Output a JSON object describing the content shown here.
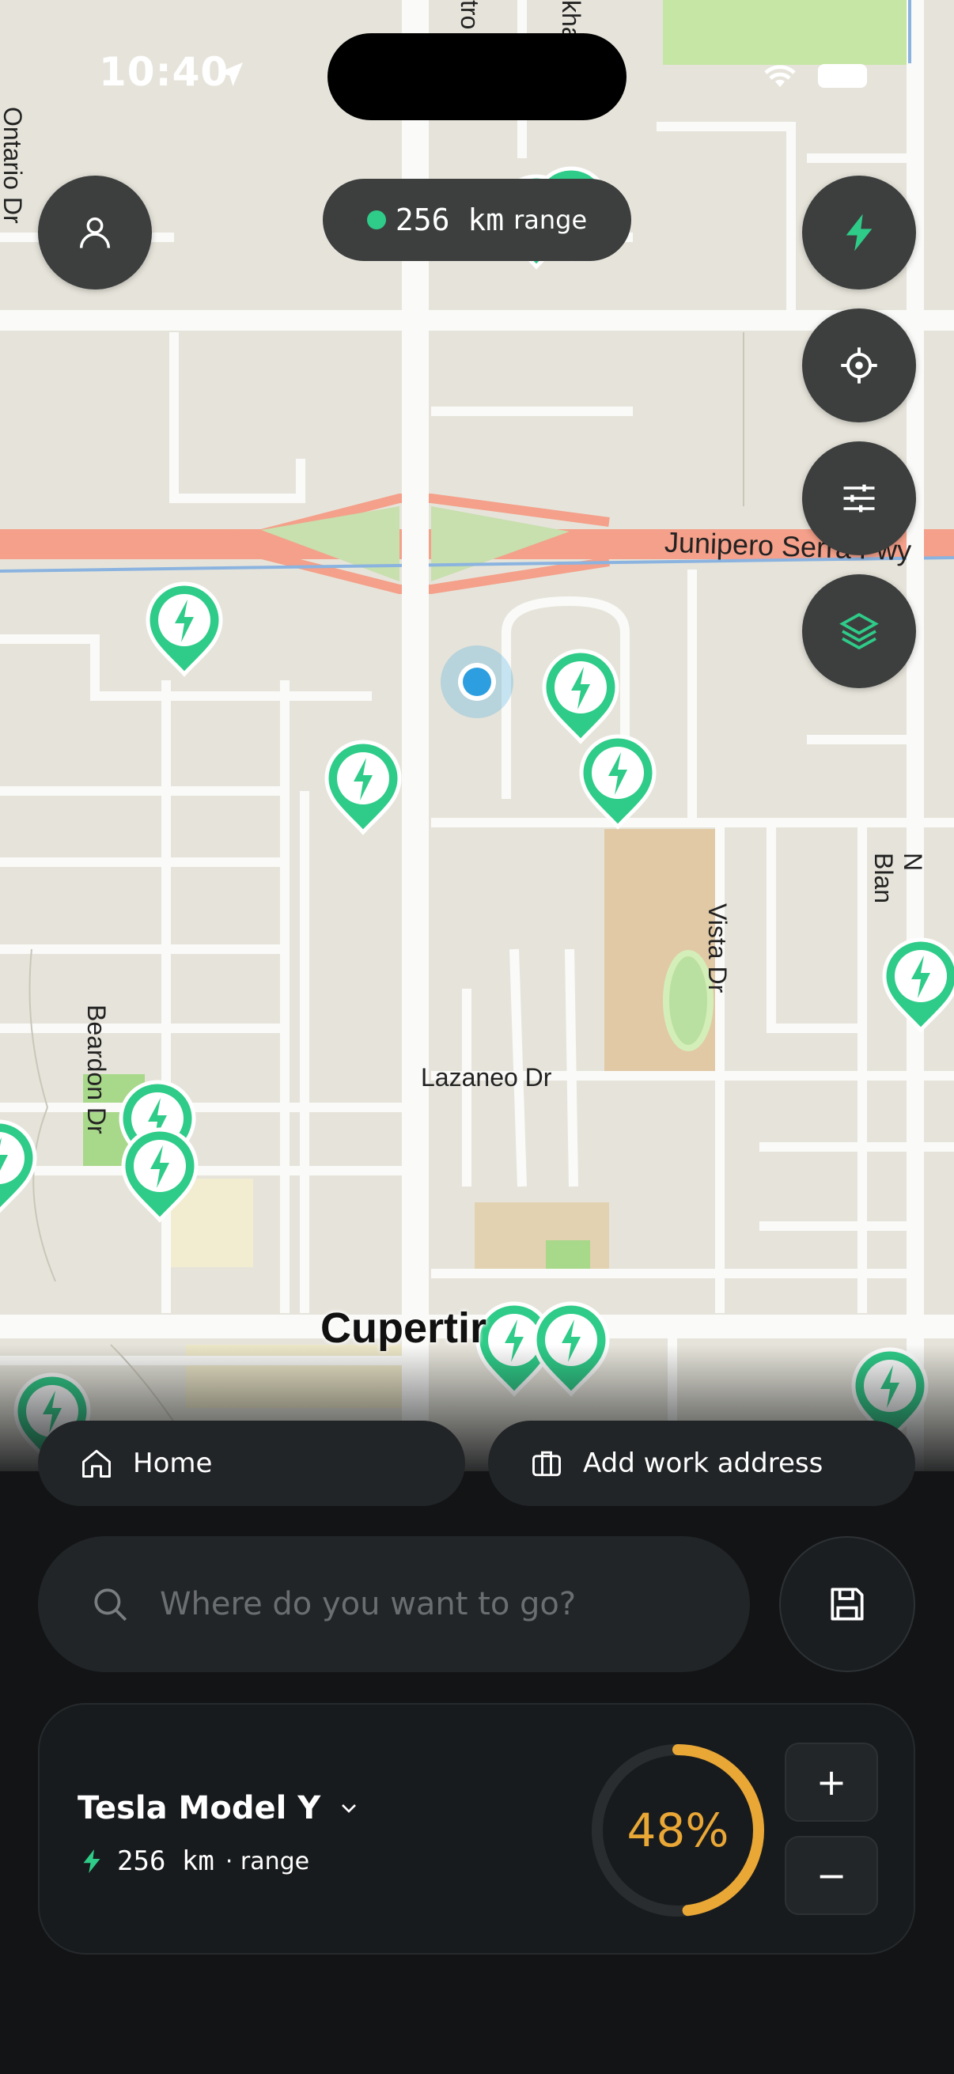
{
  "status_bar": {
    "time": "10:40"
  },
  "range_pill": {
    "value": "256 km",
    "label": "range"
  },
  "map": {
    "labels": {
      "freeway": "Junipero Serra Fwy",
      "lazaneo": "Lazaneo Dr",
      "beardon": "Beardon Dr",
      "vista": "Vista Dr",
      "ontario": "Ontario Dr",
      "blaney": "N Blan",
      "city": "Cupertir",
      "top_a": "tro",
      "top_b": "kha"
    }
  },
  "shortcuts": {
    "home": "Home",
    "work": "Add work address"
  },
  "search": {
    "placeholder": "Where do you want to go?"
  },
  "vehicle": {
    "name": "Tesla Model Y",
    "range_value": "256 km",
    "range_label": "· range",
    "battery_percent": "48%",
    "battery_level": 0.48,
    "increase_label": "+",
    "decrease_label": "−"
  },
  "colors": {
    "accent": "#2ecc88",
    "battery": "#e9a736",
    "map_bg": "#e6e4da",
    "freeway": "#f4a08a",
    "location": "#2d9fe0"
  },
  "icons": [
    "profile-icon",
    "lightning-icon",
    "locate-icon",
    "filters-icon",
    "layers-icon",
    "home-icon",
    "briefcase-icon",
    "search-icon",
    "save-icon",
    "chevron-down-icon",
    "charger-pin-icon"
  ]
}
